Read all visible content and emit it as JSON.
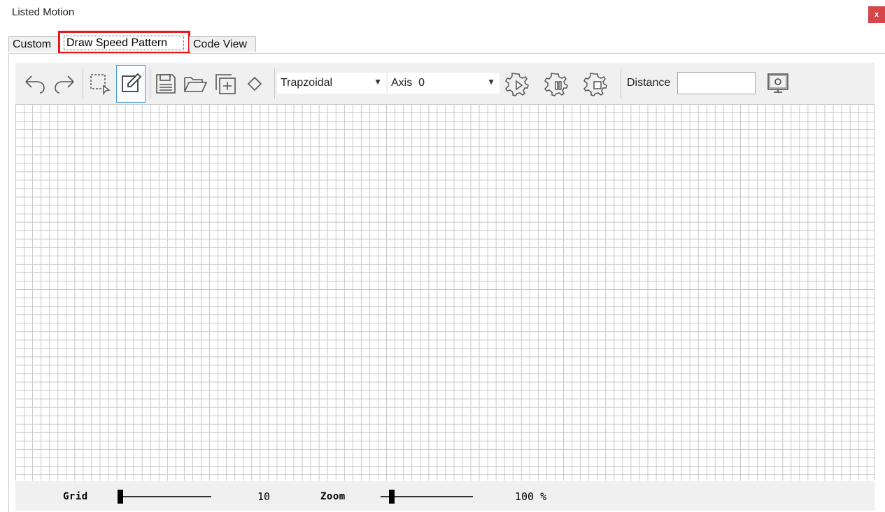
{
  "window": {
    "title": "Listed Motion",
    "close_label": "x"
  },
  "tabs": [
    {
      "label": "Custom",
      "active": false
    },
    {
      "label": "Draw Speed Pattern",
      "active": true
    },
    {
      "label": "Code View",
      "active": false
    }
  ],
  "toolbar": {
    "icons": [
      "undo-icon",
      "redo-icon",
      "select-area-icon",
      "draw-icon",
      "save-icon",
      "open-folder-icon",
      "add-new-icon",
      "eraser-icon",
      "gear-play-icon",
      "gear-pause-icon",
      "gear-stop-icon",
      "monitor-icon"
    ],
    "profile_select": "Trapzoidal",
    "axis_select": "Axis  0",
    "distance_label": "Distance",
    "distance_value": ""
  },
  "status": {
    "grid_label": "Grid",
    "grid_value": "10",
    "zoom_label": "Zoom",
    "zoom_value": "100 %"
  },
  "colors": {
    "accent_red": "#e8151a",
    "close_red": "#d54549",
    "active_blue": "#4a9be0"
  }
}
